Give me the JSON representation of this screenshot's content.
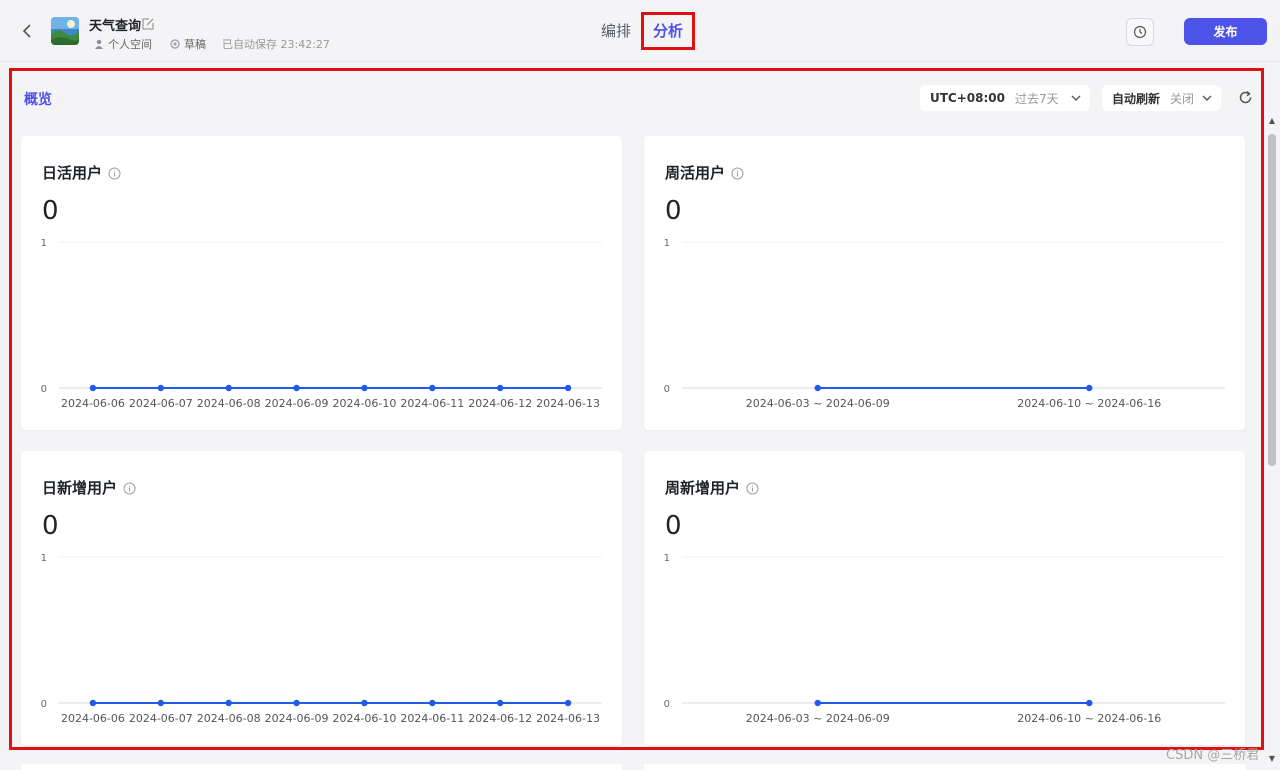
{
  "header": {
    "app_title": "天气查询",
    "workspace": "个人空间",
    "status": "草稿",
    "autosave": "已自动保存 23:42:27",
    "tabs": [
      {
        "label": "编排",
        "active": false
      },
      {
        "label": "分析",
        "active": true
      }
    ],
    "publish_label": "发布"
  },
  "toolbar": {
    "overview_label": "概览",
    "timezone": "UTC+08:00",
    "range": "过去7天",
    "auto_refresh_label": "自动刷新",
    "auto_refresh_value": "关闭"
  },
  "colors": {
    "accent": "#4d53e8",
    "line": "#1f5ae8",
    "highlight_border": "#e01010"
  },
  "cards": [
    {
      "title": "日活用户",
      "value": "0",
      "chart_data": {
        "type": "line",
        "categories": [
          "2024-06-06",
          "2024-06-07",
          "2024-06-08",
          "2024-06-09",
          "2024-06-10",
          "2024-06-11",
          "2024-06-12",
          "2024-06-13"
        ],
        "values": [
          0,
          0,
          0,
          0,
          0,
          0,
          0,
          0
        ],
        "ylim": [
          0,
          1
        ],
        "yticks": [
          "0",
          "1"
        ]
      }
    },
    {
      "title": "周活用户",
      "value": "0",
      "chart_data": {
        "type": "line",
        "categories": [
          "2024-06-03 ~ 2024-06-09",
          "2024-06-10 ~ 2024-06-16"
        ],
        "values": [
          0,
          0
        ],
        "ylim": [
          0,
          1
        ],
        "yticks": [
          "0",
          "1"
        ]
      }
    },
    {
      "title": "日新增用户",
      "value": "0",
      "chart_data": {
        "type": "line",
        "categories": [
          "2024-06-06",
          "2024-06-07",
          "2024-06-08",
          "2024-06-09",
          "2024-06-10",
          "2024-06-11",
          "2024-06-12",
          "2024-06-13"
        ],
        "values": [
          0,
          0,
          0,
          0,
          0,
          0,
          0,
          0
        ],
        "ylim": [
          0,
          1
        ],
        "yticks": [
          "0",
          "1"
        ]
      }
    },
    {
      "title": "周新增用户",
      "value": "0",
      "chart_data": {
        "type": "line",
        "categories": [
          "2024-06-03 ~ 2024-06-09",
          "2024-06-10 ~ 2024-06-16"
        ],
        "values": [
          0,
          0
        ],
        "ylim": [
          0,
          1
        ],
        "yticks": [
          "0",
          "1"
        ]
      }
    }
  ],
  "watermark": "CSDN @三桥君"
}
